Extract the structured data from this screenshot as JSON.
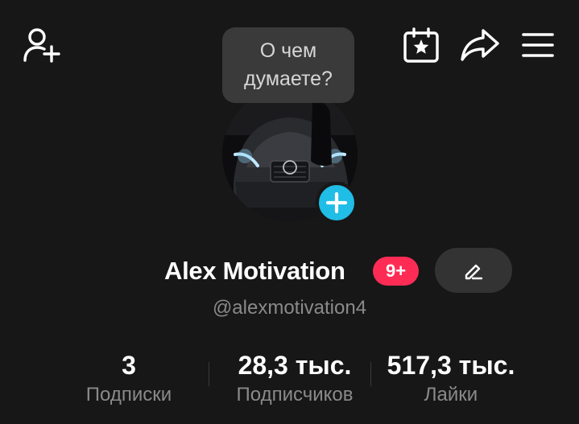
{
  "header": {
    "add_user_icon": "add-user-icon",
    "calendar_icon": "calendar-star-icon",
    "share_icon": "share-arrow-icon",
    "menu_icon": "hamburger-menu-icon"
  },
  "prompt_bubble": {
    "text": "О чем думаете?"
  },
  "profile": {
    "display_name": "Alex Motivation",
    "badge": "9+",
    "username": "@alexmotivation4",
    "edit_icon": "pencil-icon",
    "add_story_icon": "plus-icon"
  },
  "stats": {
    "following": {
      "value": "3",
      "label": "Подписки"
    },
    "followers": {
      "value": "28,3 тыс.",
      "label": "Подписчиков"
    },
    "likes": {
      "value": "517,3 тыс.",
      "label": "Лайки"
    }
  },
  "colors": {
    "background": "#171717",
    "accent_blue": "#20bde6",
    "badge_red": "#fe2c55",
    "muted_text": "#8a8a8a"
  }
}
